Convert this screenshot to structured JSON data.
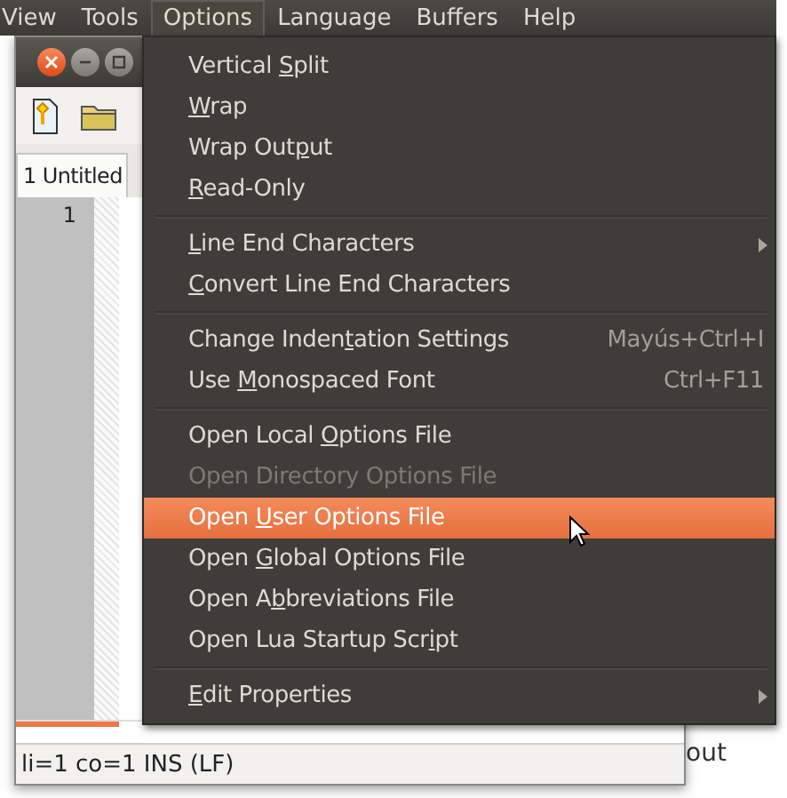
{
  "menubar": [
    {
      "label": "View",
      "selected": false
    },
    {
      "label": "Tools",
      "selected": false
    },
    {
      "label": "Options",
      "selected": true
    },
    {
      "label": "Language",
      "selected": false
    },
    {
      "label": "Buffers",
      "selected": false
    },
    {
      "label": "Help",
      "selected": false
    }
  ],
  "page_text": "out",
  "editor": {
    "tab": "1 Untitled",
    "line_number": "1",
    "status_bar": "li=1 co=1 INS (LF)"
  },
  "menu": [
    {
      "kind": "item",
      "label": {
        "before": "Vertical ",
        "mnemonic": "S",
        "after": "plit"
      },
      "disabled": false,
      "selected": false,
      "submenu": false
    },
    {
      "kind": "item",
      "label": {
        "mnemonic": "W",
        "after": "rap"
      },
      "disabled": false,
      "selected": false,
      "submenu": false
    },
    {
      "kind": "item",
      "label": {
        "before": "Wrap Out",
        "mnemonic": "p",
        "after": "ut"
      },
      "disabled": false,
      "selected": false,
      "submenu": false
    },
    {
      "kind": "item",
      "label": {
        "mnemonic": "R",
        "after": "ead-Only"
      },
      "disabled": false,
      "selected": false,
      "submenu": false
    },
    {
      "kind": "separator"
    },
    {
      "kind": "item",
      "label": {
        "mnemonic": "L",
        "after": "ine End Characters"
      },
      "disabled": false,
      "selected": false,
      "submenu": true
    },
    {
      "kind": "item",
      "label": {
        "mnemonic": "C",
        "after": "onvert Line End Characters"
      },
      "disabled": false,
      "selected": false,
      "submenu": false
    },
    {
      "kind": "separator"
    },
    {
      "kind": "item",
      "label": {
        "before": "Change Inden",
        "mnemonic": "t",
        "after": "ation Settings"
      },
      "shortcut": "Mayús+Ctrl+I",
      "disabled": false,
      "selected": false,
      "submenu": false
    },
    {
      "kind": "item",
      "label": {
        "before": "Use ",
        "mnemonic": "M",
        "after": "onospaced Font"
      },
      "shortcut": "Ctrl+F11",
      "disabled": false,
      "selected": false,
      "submenu": false
    },
    {
      "kind": "separator"
    },
    {
      "kind": "item",
      "label": {
        "before": "Open Local ",
        "mnemonic": "O",
        "after": "ptions File"
      },
      "disabled": false,
      "selected": false,
      "submenu": false
    },
    {
      "kind": "item",
      "label": {
        "before": "Open Directory Options File"
      },
      "disabled": true,
      "selected": false,
      "submenu": false
    },
    {
      "kind": "item",
      "label": {
        "before": "Open ",
        "mnemonic": "U",
        "after": "ser Options File"
      },
      "disabled": false,
      "selected": true,
      "submenu": false
    },
    {
      "kind": "item",
      "label": {
        "before": "Open ",
        "mnemonic": "G",
        "after": "lobal Options File"
      },
      "disabled": false,
      "selected": false,
      "submenu": false
    },
    {
      "kind": "item",
      "label": {
        "before": "Open A",
        "mnemonic": "b",
        "after": "breviations File"
      },
      "disabled": false,
      "selected": false,
      "submenu": false
    },
    {
      "kind": "item",
      "label": {
        "before": "Open Lua Startup Scr",
        "mnemonic": "i",
        "after": "pt"
      },
      "disabled": false,
      "selected": false,
      "submenu": false
    },
    {
      "kind": "separator"
    },
    {
      "kind": "item",
      "label": {
        "mnemonic": "E",
        "after": "dit Properties"
      },
      "disabled": false,
      "selected": false,
      "submenu": true
    }
  ]
}
